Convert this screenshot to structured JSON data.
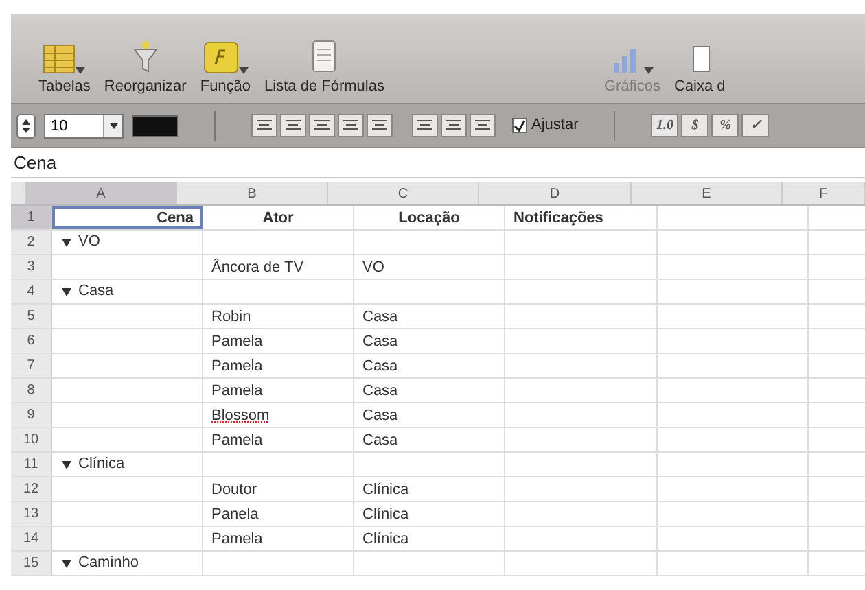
{
  "toolbar": {
    "items": [
      {
        "label": "Tabelas",
        "disabled": false
      },
      {
        "label": "Reorganizar",
        "disabled": false
      },
      {
        "label": "Função",
        "disabled": false
      },
      {
        "label": "Lista de Fórmulas",
        "disabled": false
      },
      {
        "label": "Gráficos",
        "disabled": true
      },
      {
        "label": "Caixa d",
        "disabled": false
      }
    ]
  },
  "format_bar": {
    "font_size": "10",
    "wrap": {
      "label": "Ajustar",
      "checked": true
    },
    "number_buttons": [
      "1.0",
      "$",
      "%",
      "✓"
    ]
  },
  "formula_bar": {
    "value": "Cena"
  },
  "table": {
    "columns": [
      {
        "label": "A",
        "selected": true
      },
      {
        "label": "B",
        "selected": false
      },
      {
        "label": "C",
        "selected": false
      },
      {
        "label": "D",
        "selected": false
      },
      {
        "label": "E",
        "selected": false
      },
      {
        "label": "F",
        "selected": false
      }
    ],
    "rows": [
      {
        "number": "1",
        "kind": "header",
        "cells": [
          "Cena",
          "Ator",
          "Locação",
          "Notificações"
        ],
        "selected": true
      },
      {
        "number": "2",
        "kind": "group",
        "label": "VO",
        "expanded": true,
        "selected": false
      },
      {
        "number": "3",
        "kind": "data",
        "cells": [
          "",
          "Âncora de TV",
          "VO",
          ""
        ],
        "selected": false
      },
      {
        "number": "4",
        "kind": "group",
        "label": "Casa",
        "expanded": true,
        "selected": false
      },
      {
        "number": "5",
        "kind": "data",
        "cells": [
          "",
          "Robin",
          "Casa",
          ""
        ],
        "selected": false
      },
      {
        "number": "6",
        "kind": "data",
        "cells": [
          "",
          "Pamela",
          "Casa",
          ""
        ],
        "selected": false
      },
      {
        "number": "7",
        "kind": "data",
        "cells": [
          "",
          "Pamela",
          "Casa",
          ""
        ],
        "selected": false
      },
      {
        "number": "8",
        "kind": "data",
        "cells": [
          "",
          "Pamela",
          "Casa",
          ""
        ],
        "selected": false
      },
      {
        "number": "9",
        "kind": "data",
        "cells": [
          "",
          "Blossom",
          "Casa",
          ""
        ],
        "selected": false,
        "misspelled": true
      },
      {
        "number": "10",
        "kind": "data",
        "cells": [
          "",
          "Pamela",
          "Casa",
          ""
        ],
        "selected": false
      },
      {
        "number": "11",
        "kind": "group",
        "label": "Clínica",
        "expanded": true,
        "selected": false
      },
      {
        "number": "12",
        "kind": "data",
        "cells": [
          "",
          "Doutor",
          "Clínica",
          ""
        ],
        "selected": false
      },
      {
        "number": "13",
        "kind": "data",
        "cells": [
          "",
          "Panela",
          "Clínica",
          ""
        ],
        "selected": false
      },
      {
        "number": "14",
        "kind": "data",
        "cells": [
          "",
          "Pamela",
          "Clínica",
          ""
        ],
        "selected": false
      },
      {
        "number": "15",
        "kind": "group",
        "label": "Caminho",
        "expanded": true,
        "selected": false
      }
    ]
  }
}
